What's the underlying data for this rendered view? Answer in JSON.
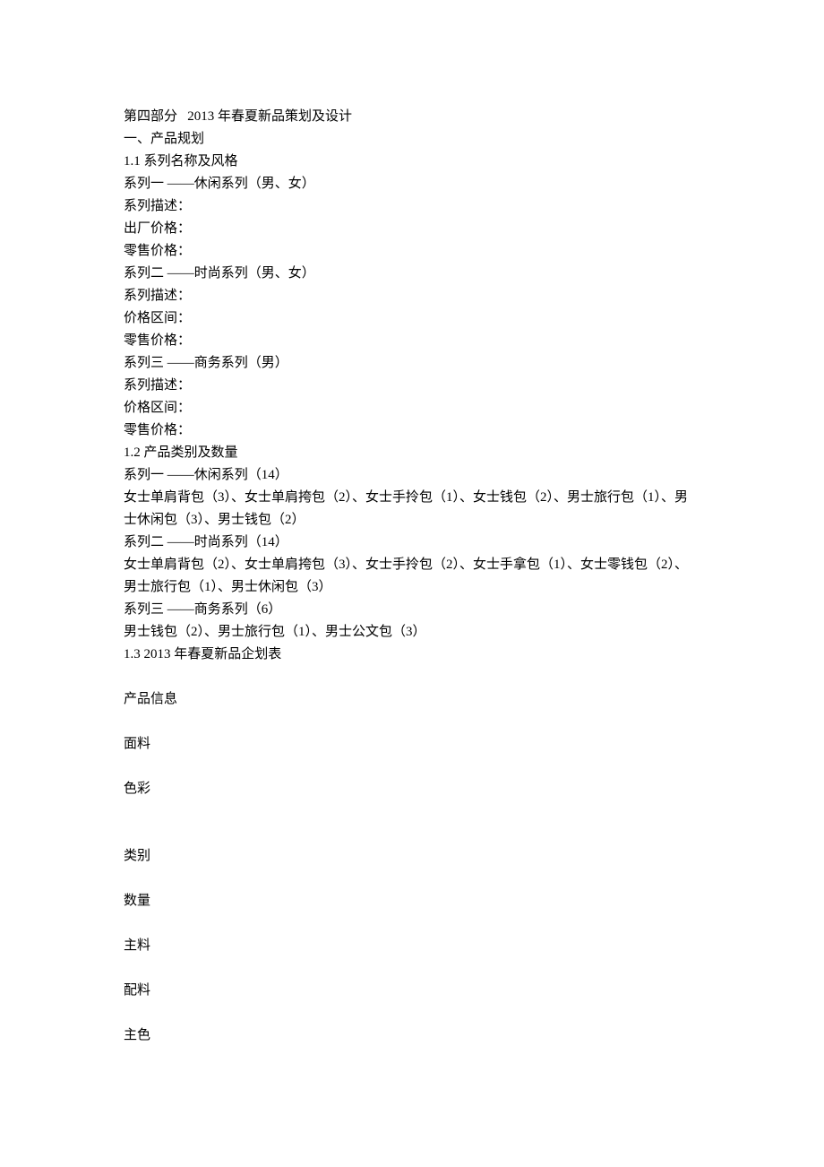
{
  "lines": {
    "l1": "第四部分   2013 年春夏新品策划及设计",
    "l2": "一、产品规划",
    "l3": "1.1 系列名称及风格",
    "l4": "系列一 ——休闲系列（男、女）",
    "l5": "系列描述：",
    "l6": "出厂价格：",
    "l7": "零售价格：",
    "l8": "系列二 ——时尚系列（男、女）",
    "l9": "系列描述：",
    "l10": "价格区间：",
    "l11": "零售价格：",
    "l12": "系列三 ——商务系列（男）",
    "l13": "系列描述：",
    "l14": "价格区间：",
    "l15": "零售价格：",
    "l16": "1.2 产品类别及数量",
    "l17": "系列一 ——休闲系列（14）",
    "l18": "女士单肩背包（3）、女士单肩挎包（2）、女士手拎包（1）、女士钱包（2）、男士旅行包（1）、男士休闲包（3）、男士钱包（2）",
    "l19": "系列二 ——时尚系列（14）",
    "l20": "女士单肩背包（2）、女士单肩挎包（3）、女士手拎包（2）、女士手拿包（1）、女士零钱包（2）、男士旅行包（1）、男士休闲包（3）",
    "l21": "系列三 ——商务系列（6）",
    "l22": "男士钱包（2）、男士旅行包（1）、男士公文包（3）",
    "l23": "1.3 2013 年春夏新品企划表",
    "l24": "产品信息",
    "l25": "面料",
    "l26": "色彩",
    "l27": "类别",
    "l28": "数量",
    "l29": "主料",
    "l30": "配料",
    "l31": "主色"
  }
}
